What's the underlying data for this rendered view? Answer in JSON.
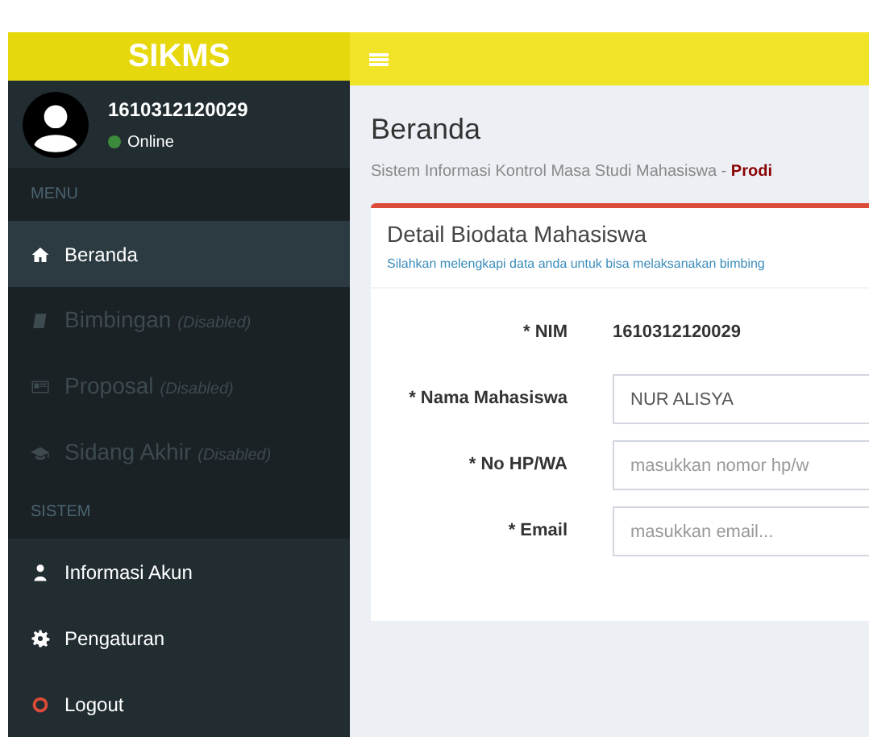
{
  "brand": "SIKMS",
  "user": {
    "name": "1610312120029",
    "status": "Online",
    "online": true
  },
  "sidebar": [
    {
      "header": "MENU",
      "items": [
        {
          "label": "Beranda",
          "selected": true,
          "disabled": false
        },
        {
          "label": "Bimbingan",
          "note": "(Disabled)",
          "selected": false,
          "disabled": true
        },
        {
          "label": "Proposal",
          "note": "(Disabled)",
          "selected": false,
          "disabled": true
        },
        {
          "label": "Sidang Akhir",
          "note": "(Disabled)",
          "selected": false,
          "disabled": true
        }
      ]
    },
    {
      "header": "SISTEM",
      "items": [
        {
          "label": "Informasi Akun",
          "selected": false,
          "disabled": false
        },
        {
          "label": "Pengaturan",
          "selected": false,
          "disabled": false
        },
        {
          "label": "Logout",
          "selected": false,
          "disabled": false
        }
      ]
    }
  ],
  "page": {
    "title": "Beranda",
    "subtitle": "Sistem Informasi Kontrol Masa Studi Mahasiswa - **Prodi**"
  },
  "box": {
    "title": "Detail Biodata Mahasiswa",
    "hint": "Silahkan melengkapi data anda untuk bisa melaksanakan bimbing",
    "fields": [
      {
        "kind": "text",
        "label": "* NIM",
        "value": "1610312120029"
      },
      {
        "kind": "input",
        "label": "* Nama Mahasiswa",
        "value": "NUR ALISYA"
      },
      {
        "kind": "input",
        "label": "* No HP/WA",
        "placeholder": "masukkan nomor hp/w"
      },
      {
        "kind": "input",
        "label": "* Email",
        "placeholder": "masukkan email..."
      }
    ]
  }
}
